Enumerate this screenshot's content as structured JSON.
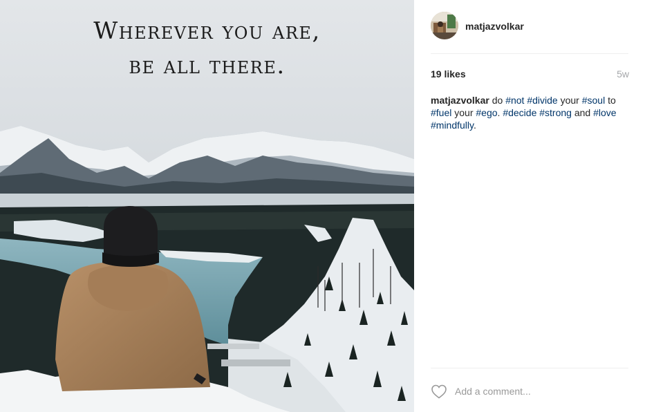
{
  "post": {
    "image": {
      "quote_line1": "Wherever you are,",
      "quote_line2": "be all there."
    },
    "author": {
      "username": "matjazvolkar",
      "avatar_icon": "user-avatar"
    },
    "likes": "19 likes",
    "time_ago": "5w",
    "caption": {
      "username": "matjazvolkar",
      "segments": [
        {
          "text": "do ",
          "type": "text"
        },
        {
          "text": "#not",
          "type": "tag"
        },
        {
          "text": " ",
          "type": "text"
        },
        {
          "text": "#divide",
          "type": "tag"
        },
        {
          "text": " your ",
          "type": "text"
        },
        {
          "text": "#soul",
          "type": "tag"
        },
        {
          "text": " to ",
          "type": "text"
        },
        {
          "text": "#fuel",
          "type": "tag"
        },
        {
          "text": " your ",
          "type": "text"
        },
        {
          "text": "#ego",
          "type": "tag"
        },
        {
          "text": ". ",
          "type": "text"
        },
        {
          "text": "#decide",
          "type": "tag"
        },
        {
          "text": " ",
          "type": "text"
        },
        {
          "text": "#strong",
          "type": "tag"
        },
        {
          "text": " and ",
          "type": "text"
        },
        {
          "text": "#love",
          "type": "tag"
        },
        {
          "text": " ",
          "type": "text"
        },
        {
          "text": "#mindfully",
          "type": "tag"
        },
        {
          "text": ".",
          "type": "text"
        }
      ]
    },
    "comment": {
      "placeholder": "Add a comment...",
      "like_icon": "heart-icon"
    },
    "colors": {
      "hashtag": "#003569",
      "muted": "#a5a7aa",
      "divider": "#efefef"
    }
  }
}
